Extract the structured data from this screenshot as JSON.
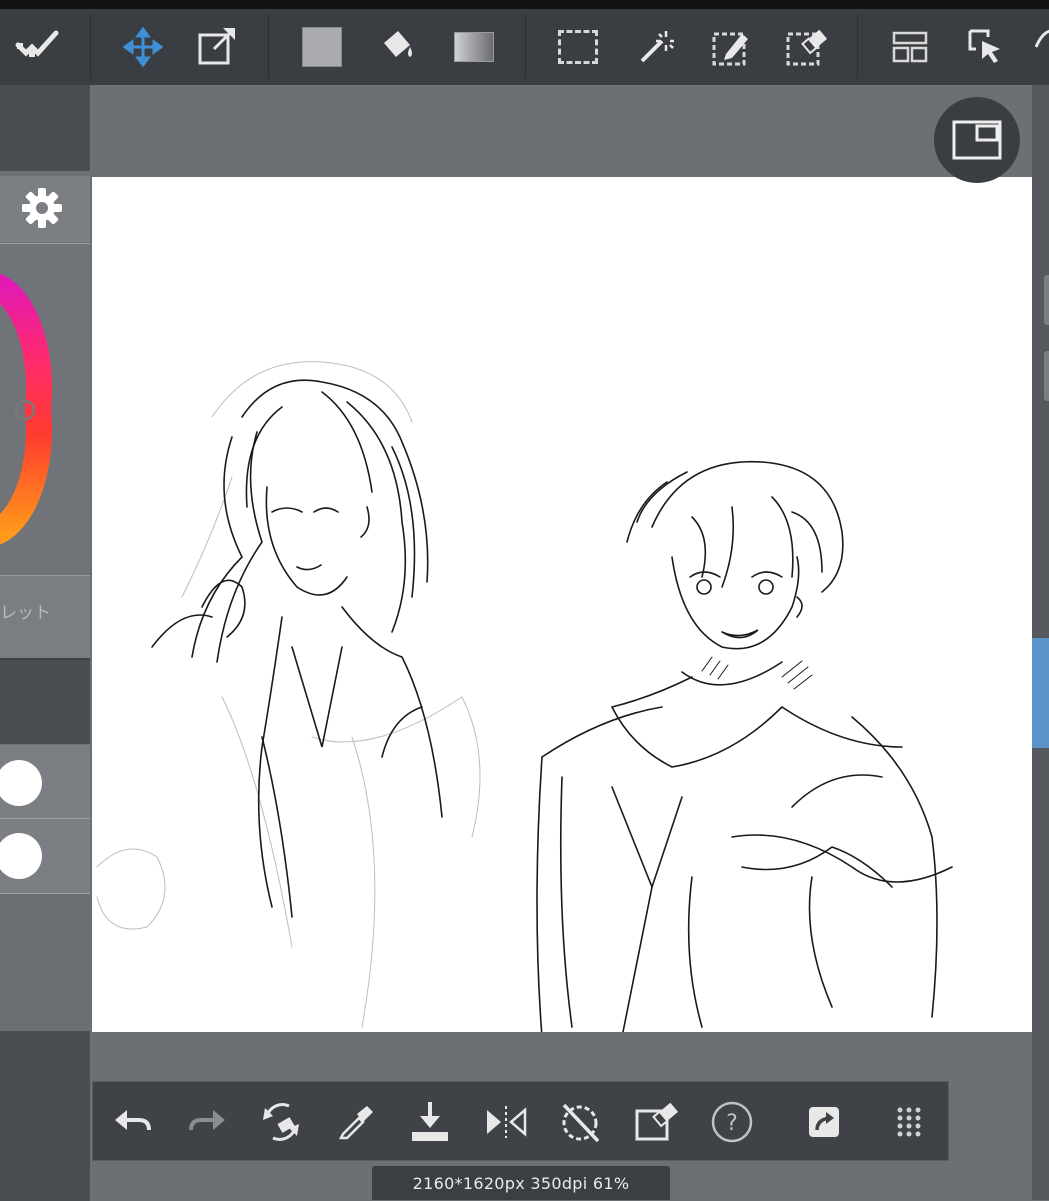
{
  "toolbar": {
    "tools": [
      {
        "name": "snap-icon"
      },
      {
        "name": "move-icon"
      },
      {
        "name": "transform-icon"
      },
      {
        "name": "fill-color-icon"
      },
      {
        "name": "bucket-icon"
      },
      {
        "name": "gradient-icon"
      },
      {
        "name": "select-rect-icon"
      },
      {
        "name": "magic-wand-icon"
      },
      {
        "name": "select-pen-icon"
      },
      {
        "name": "select-eraser-icon"
      },
      {
        "name": "layout-icon"
      },
      {
        "name": "select-cursor-icon"
      }
    ],
    "accent_color": "#3d8fd6"
  },
  "left_panel": {
    "palette_label": "レット"
  },
  "status_bar": {
    "text": "2160*1620px 350dpi 61%"
  },
  "bottom_bar": {
    "tools": [
      {
        "name": "undo-icon"
      },
      {
        "name": "redo-icon"
      },
      {
        "name": "rotate-canvas-icon"
      },
      {
        "name": "eyedropper-icon"
      },
      {
        "name": "save-download-icon"
      },
      {
        "name": "flip-horizontal-icon"
      },
      {
        "name": "reset-rotation-icon"
      },
      {
        "name": "edit-selection-icon"
      },
      {
        "name": "help-icon"
      },
      {
        "name": "share-icon"
      },
      {
        "name": "grid-menu-icon"
      }
    ]
  },
  "colors": {
    "toolbar_bg": "#3a3d41",
    "canvas_bg": "#6c6f73",
    "artboard": "#ffffff",
    "selected_layer": "#5b93c9"
  }
}
